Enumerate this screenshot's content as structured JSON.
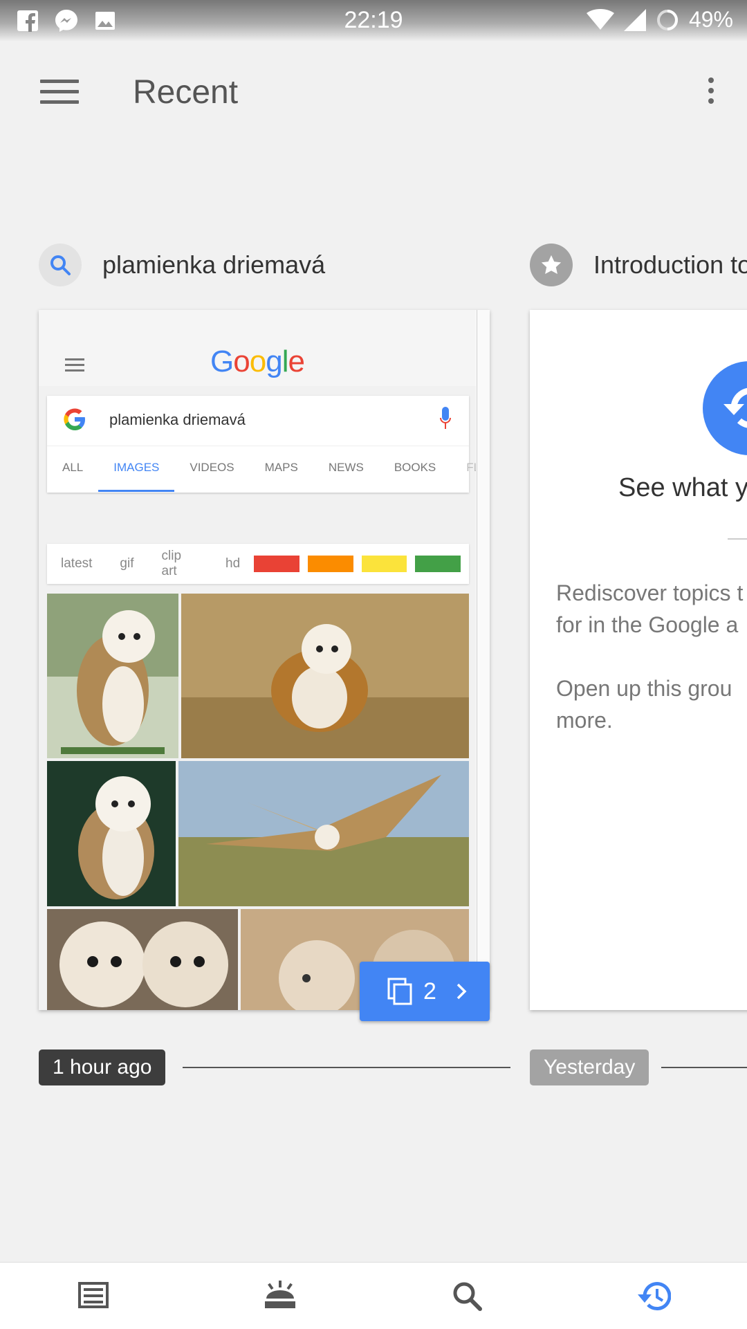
{
  "status_bar": {
    "time": "22:19",
    "battery": "49%",
    "notification_icons": [
      "facebook-icon",
      "messenger-icon",
      "gallery-icon"
    ],
    "system_icons": [
      "wifi-icon",
      "cell-signal-icon",
      "battery-icon"
    ]
  },
  "app_bar": {
    "title": "Recent",
    "icons": [
      "hamburger-menu-icon",
      "more-vert-icon"
    ]
  },
  "stories": [
    {
      "header": "plamienka driemavá",
      "icon": "search-icon",
      "preview": {
        "logo": "Google",
        "query": "plamienka driemavá",
        "tabs": [
          "ALL",
          "IMAGES",
          "VIDEOS",
          "MAPS",
          "NEWS",
          "BOOKS",
          "FLIG"
        ],
        "active_tab": "IMAGES",
        "chips": [
          "latest",
          "gif",
          "clip art",
          "hd"
        ],
        "color_swatches": [
          "#e94235",
          "#fb8c00",
          "#fbe33b",
          "#43a047"
        ]
      },
      "tab_count": "2",
      "time": "1 hour ago"
    },
    {
      "header": "Introduction to",
      "icon": "star-icon",
      "card": {
        "heading": "See what yo",
        "paragraph1": [
          "Rediscover topics t",
          "for in the Google a"
        ],
        "paragraph2": [
          "Open up this grou",
          "more."
        ]
      },
      "time": "Yesterday"
    }
  ],
  "bottom_nav": {
    "items": [
      "feed-icon",
      "updates-icon",
      "search-icon",
      "recent-icon"
    ],
    "active": "recent-icon",
    "active_color": "#4285f4"
  },
  "colors": {
    "background": "#f1f1f1",
    "accent": "#4285f4",
    "chip_dark": "#3d3d3d",
    "chip_light": "#a3a3a3"
  }
}
